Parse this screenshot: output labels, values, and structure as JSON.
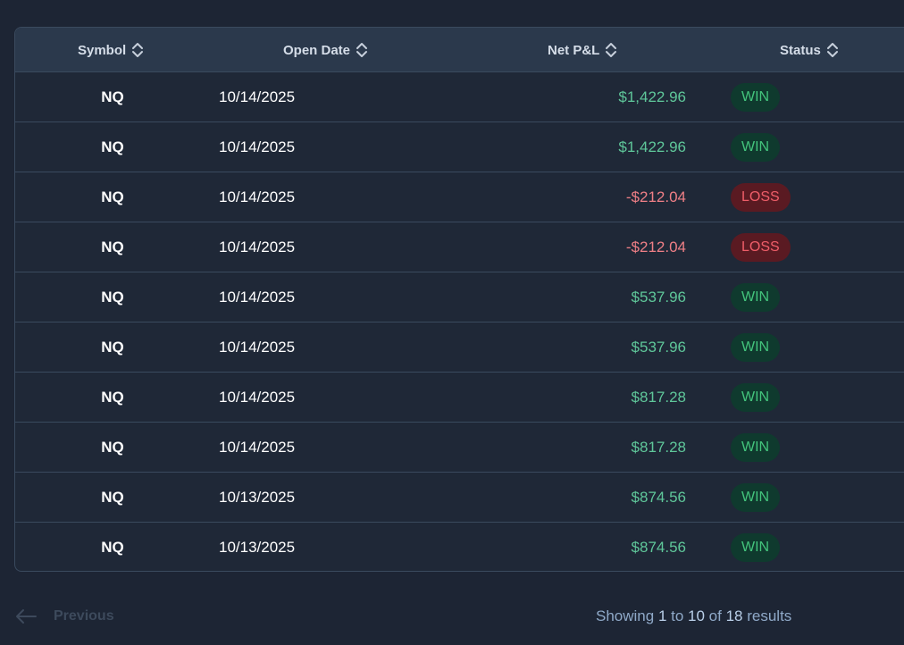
{
  "table": {
    "columns": [
      {
        "label": "Symbol"
      },
      {
        "label": "Open Date"
      },
      {
        "label": "Net P&L"
      },
      {
        "label": "Status"
      }
    ],
    "rows": [
      {
        "symbol": "NQ",
        "open_date": "10/14/2025",
        "net_pnl": "$1,422.96",
        "status": "WIN"
      },
      {
        "symbol": "NQ",
        "open_date": "10/14/2025",
        "net_pnl": "$1,422.96",
        "status": "WIN"
      },
      {
        "symbol": "NQ",
        "open_date": "10/14/2025",
        "net_pnl": "-$212.04",
        "status": "LOSS"
      },
      {
        "symbol": "NQ",
        "open_date": "10/14/2025",
        "net_pnl": "-$212.04",
        "status": "LOSS"
      },
      {
        "symbol": "NQ",
        "open_date": "10/14/2025",
        "net_pnl": "$537.96",
        "status": "WIN"
      },
      {
        "symbol": "NQ",
        "open_date": "10/14/2025",
        "net_pnl": "$537.96",
        "status": "WIN"
      },
      {
        "symbol": "NQ",
        "open_date": "10/14/2025",
        "net_pnl": "$817.28",
        "status": "WIN"
      },
      {
        "symbol": "NQ",
        "open_date": "10/14/2025",
        "net_pnl": "$817.28",
        "status": "WIN"
      },
      {
        "symbol": "NQ",
        "open_date": "10/13/2025",
        "net_pnl": "$874.56",
        "status": "WIN"
      },
      {
        "symbol": "NQ",
        "open_date": "10/13/2025",
        "net_pnl": "$874.56",
        "status": "WIN"
      }
    ]
  },
  "pagination": {
    "previous_label": "Previous",
    "showing_prefix": "Showing ",
    "from": "1",
    "to_word": " to ",
    "to": "10",
    "of_word": " of ",
    "total": "18",
    "suffix": " results"
  },
  "colors": {
    "background": "#1d2534",
    "header_bg": "#2b394c",
    "win_text": "#43c47c",
    "win_bg": "#0f3a2e",
    "loss_text": "#ef5e69",
    "loss_bg": "#5a1a22",
    "pnl_positive": "#5fc79a",
    "pnl_negative": "#ef7f86"
  },
  "icons": {
    "sort": "sort-updown-icon",
    "previous": "arrow-left-icon"
  }
}
